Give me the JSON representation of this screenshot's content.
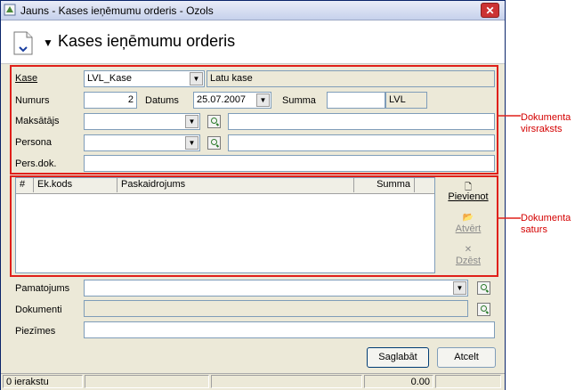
{
  "window": {
    "title": "Jauns - Kases ieņēmumu orderis - Ozols",
    "close_glyph": "✕"
  },
  "header": {
    "menu_arrow": "▼",
    "title": "Kases ieņēmumu orderis"
  },
  "form": {
    "kase": {
      "label": "Kase",
      "value": "LVL_Kase",
      "description": "Latu kase"
    },
    "numurs": {
      "label": "Numurs",
      "value": "2"
    },
    "datums": {
      "label": "Datums",
      "value": "25.07.2007"
    },
    "summa": {
      "label": "Summa",
      "value": "",
      "currency": "LVL"
    },
    "maksatajs": {
      "label": "Maksātājs",
      "value": "",
      "detail": ""
    },
    "persona": {
      "label": "Persona",
      "value": "",
      "detail": ""
    },
    "persdok": {
      "label": "Pers.dok.",
      "value": ""
    }
  },
  "grid": {
    "columns": [
      "#",
      "Ek.kods",
      "Paskaidrojums",
      "Summa"
    ],
    "rows": []
  },
  "side_buttons": {
    "add": "Pievienot",
    "open": "Atvērt",
    "delete": "Dzēst"
  },
  "footer_fields": {
    "pamatojums": {
      "label": "Pamatojums",
      "value": ""
    },
    "dokumenti": {
      "label": "Dokumenti",
      "value": ""
    },
    "piezimes": {
      "label": "Piezīmes",
      "value": ""
    }
  },
  "buttons": {
    "save": "Saglabāt",
    "cancel": "Atcelt"
  },
  "status": {
    "records": "0 ierakstu",
    "total": "0.00"
  },
  "annotations": {
    "header_section": [
      "Dokumenta",
      "virsraksts"
    ],
    "content_section": [
      "Dokumenta",
      "saturs"
    ]
  },
  "colors": {
    "annotation_red": "#e0201a",
    "title_bar": "#c6d1ec",
    "window_bg": "#ece9d8"
  }
}
